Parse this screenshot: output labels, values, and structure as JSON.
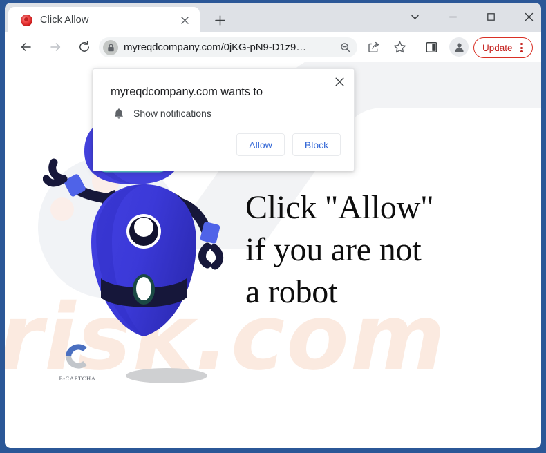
{
  "window": {
    "controls": [
      {
        "name": "tab-search",
        "glyph": "chevron-down"
      },
      {
        "name": "minimize",
        "glyph": "minus"
      },
      {
        "name": "maximize",
        "glyph": "square"
      },
      {
        "name": "close",
        "glyph": "x"
      }
    ],
    "frame_color": "#2b5797"
  },
  "tabs": {
    "active": {
      "title": "Click Allow",
      "favicon": "red-circle-icon",
      "close_label": "✕"
    },
    "new_tab_label": "+"
  },
  "toolbar": {
    "back_icon": "arrow-left-icon",
    "forward_icon": "arrow-right-icon",
    "reload_icon": "reload-icon",
    "omnibox": {
      "url": "myreqdcompany.com/0jKG-pN9-D1z9…",
      "lock_icon": "lock-icon",
      "zoom_icon": "zoom-out-icon"
    },
    "share_icon": "share-icon",
    "bookmark_icon": "star-icon",
    "sidepanel_icon": "side-panel-icon",
    "profile_icon": "avatar-icon",
    "update_label": "Update",
    "update_menu_icon": "three-dot-menu-icon",
    "update_color": "#c5221f"
  },
  "permission_dialog": {
    "title": "myreqdcompany.com wants to",
    "request": "Show notifications",
    "request_icon": "bell-icon",
    "allow_label": "Allow",
    "block_label": "Block",
    "close_label": "✕",
    "button_text_color": "#3367d6"
  },
  "page": {
    "headline_lines": [
      "Click \"Allow\"",
      "if you are not",
      "a robot"
    ],
    "watermark": "risk.com",
    "captcha_logo": {
      "caption": "E-CAPTCHA",
      "arc_top_color": "#4a6fc0",
      "arc_bottom_color": "#c2c6cb"
    },
    "robot": {
      "name": "captcha-robot-mascot",
      "body_color": "#3b39d8",
      "body_shade_color": "#2f2db4",
      "helmet_color": "#4341dd",
      "visor_color": "#143540",
      "visor_outline_color": "#5fd4d4",
      "limb_color": "#16173a",
      "cuff_color": "#4f63e8",
      "shadow_color": "#cfd0d2"
    }
  }
}
